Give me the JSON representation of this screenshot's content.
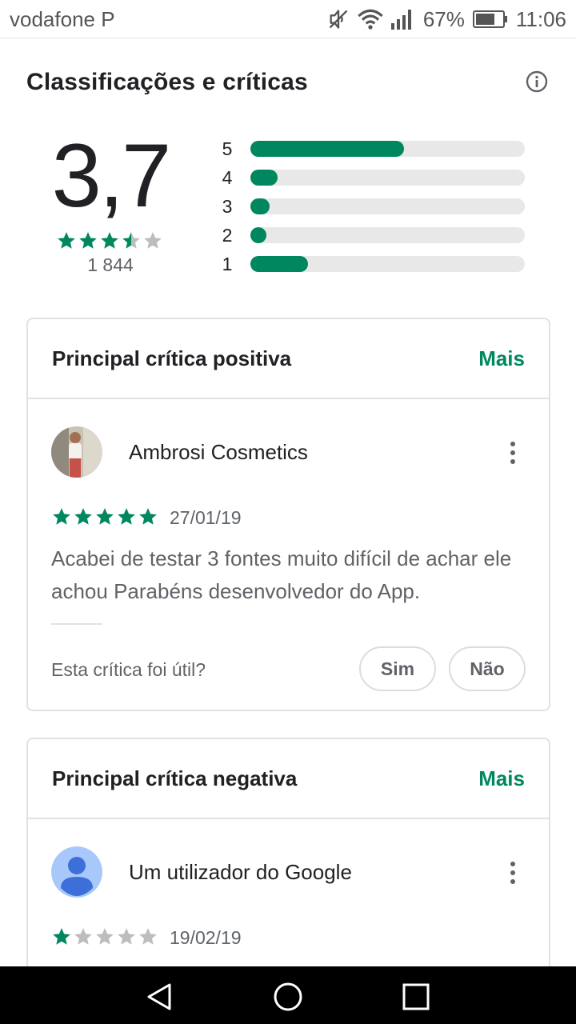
{
  "status_bar": {
    "carrier": "vodafone P",
    "battery": "67%",
    "time": "11:06",
    "icons": [
      "mute-icon",
      "wifi-icon",
      "signal-icon",
      "battery-icon"
    ]
  },
  "ratings": {
    "title": "Classificações e críticas",
    "info_icon": "info-icon",
    "score": "3,7",
    "score_stars": 3.5,
    "count": "1 844",
    "distribution": [
      {
        "label": "5",
        "fraction": 0.56
      },
      {
        "label": "4",
        "fraction": 0.1
      },
      {
        "label": "3",
        "fraction": 0.07
      },
      {
        "label": "2",
        "fraction": 0.055
      },
      {
        "label": "1",
        "fraction": 0.21
      }
    ]
  },
  "positive": {
    "header": "Principal crítica positiva",
    "more": "Mais",
    "author": "Ambrosi Cosmetics",
    "stars": 5,
    "date": "27/01/19",
    "text": "Acabei de testar 3 fontes muito difícil de achar ele achou Parabéns desenvolvedor do App.",
    "helpful_question": "Esta crítica foi útil?",
    "yes": "Sim",
    "no": "Não"
  },
  "negative": {
    "header": "Principal crítica negativa",
    "more": "Mais",
    "author": "Um utilizador do Google",
    "stars": 1,
    "date": "19/02/19"
  },
  "colors": {
    "accent": "#01875f",
    "star_empty": "#bdbdbd",
    "track": "#e8e8e8"
  }
}
